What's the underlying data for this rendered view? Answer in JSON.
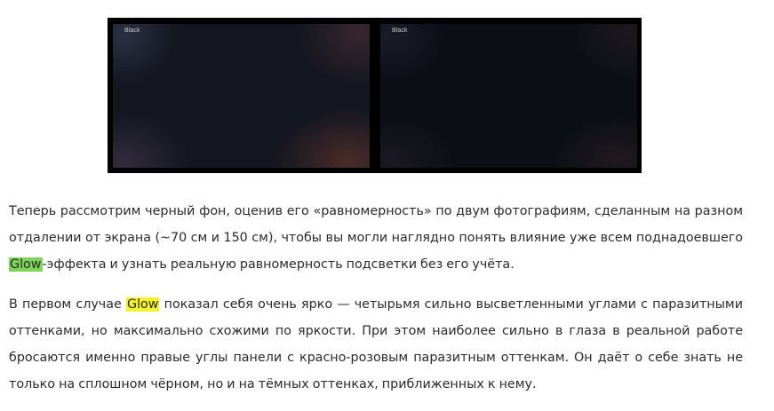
{
  "photos": {
    "left_label": "Black",
    "right_label": "Black"
  },
  "paragraphs": [
    {
      "before": "Теперь рассмотрим черный фон, оценив его «равномерность» по двум фотографиям, сделанным на разном отдалении от экрана (~70 см и 150 см), чтобы вы могли наглядно понять влияние уже всем поднадоевшего ",
      "highlight": "Glow",
      "after": "-эффекта и узнать реальную равномерность подсветки без его учёта."
    },
    {
      "before": "В первом случае ",
      "highlight": "Glow",
      "after": " показал себя очень ярко — четырьмя сильно высветленными углами с паразитными оттенками, но максимально схожими по яркости. При этом наиболее сильно в глаза в реальной работе бросаются именно правые углы панели с красно-розовым паразитным оттенкам. Он даёт о себе знать не только на сплошном чёрном, но и на тёмных оттенках, приближенных к нему."
    }
  ],
  "colors": {
    "highlight_green": "#7ed35a",
    "highlight_yellow": "#f4f42e",
    "text": "#2b2b2b"
  }
}
